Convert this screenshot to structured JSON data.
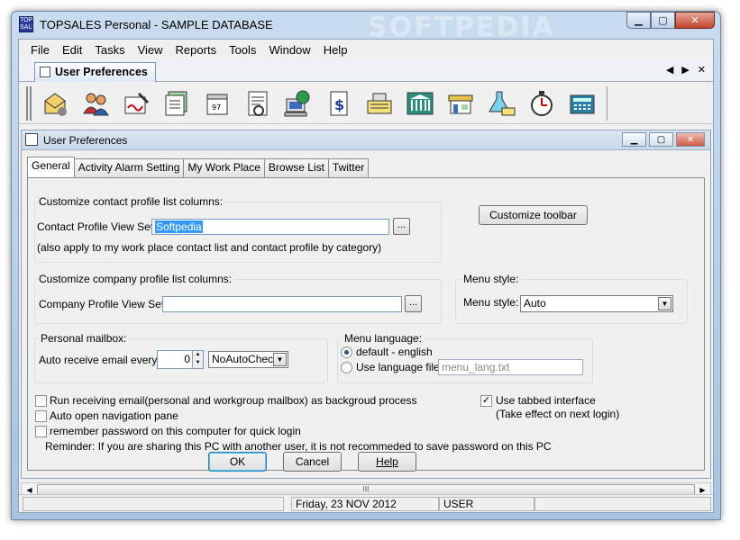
{
  "window": {
    "title": "TOPSALES Personal - SAMPLE DATABASE",
    "watermark": "SOFTPEDIA",
    "app_icon_text": "TOP SALES"
  },
  "menu": [
    "File",
    "Edit",
    "Tasks",
    "View",
    "Reports",
    "Tools",
    "Window",
    "Help"
  ],
  "doc_tab": {
    "label": "User Preferences"
  },
  "toolbar": {
    "icons": [
      "mail-icon",
      "contacts-icon",
      "signature-icon",
      "calendar-stack-icon",
      "calendar-icon",
      "letter-icon",
      "computer-globe-icon",
      "dollar-doc-icon",
      "cash-register-icon",
      "bank-icon",
      "shop-icon",
      "lab-icon",
      "stopwatch-icon",
      "calculator-icon"
    ]
  },
  "child_window": {
    "title": "User Preferences"
  },
  "tabs": [
    "General",
    "Activity Alarm Setting",
    "My Work Place",
    "Browse List",
    "Twitter"
  ],
  "general": {
    "contact_group": {
      "legend": "Customize contact profile list columns:",
      "label": "Contact Profile View Set:",
      "value": "Softpedia",
      "note": "(also apply to my work place contact list and contact profile by category)"
    },
    "customize_toolbar_label": "Customize toolbar",
    "company_group": {
      "legend": "Customize company profile list columns:",
      "label": "Company Profile View Set:",
      "value": ""
    },
    "menu_style": {
      "legend": "Menu style:",
      "label": "Menu style:",
      "value": "Auto"
    },
    "mailbox": {
      "legend": "Personal mailbox:",
      "label": "Auto receive email every:",
      "spin_value": "0",
      "unit_value": "NoAutoChec"
    },
    "menu_language": {
      "legend": "Menu language:",
      "default_label": "default - english",
      "use_file_label": "Use language file",
      "file_value": "menu_lang.txt"
    },
    "options": [
      {
        "label": "Run receiving email(personal and workgroup mailbox) as backgroud process",
        "checked": false
      },
      {
        "label": "Auto open navigation pane",
        "checked": false
      },
      {
        "label": "remember password on this computer for quick login",
        "checked": false
      }
    ],
    "tabbed": {
      "label": "Use tabbed interface",
      "note": "(Take effect on next login)",
      "checked": true
    },
    "reminder": "Reminder: If you are sharing this PC with another user, it is not recommeded to save password on this PC",
    "buttons": {
      "ok": "OK",
      "cancel": "Cancel",
      "help": "Help"
    }
  },
  "scrollbar": {
    "thumb": "III"
  },
  "status": {
    "date": "Friday, 23 NOV 2012",
    "user": "USER"
  },
  "colors": {
    "accent": "#3399ff",
    "frame": "#a8c4e0",
    "close": "#c2432c"
  }
}
